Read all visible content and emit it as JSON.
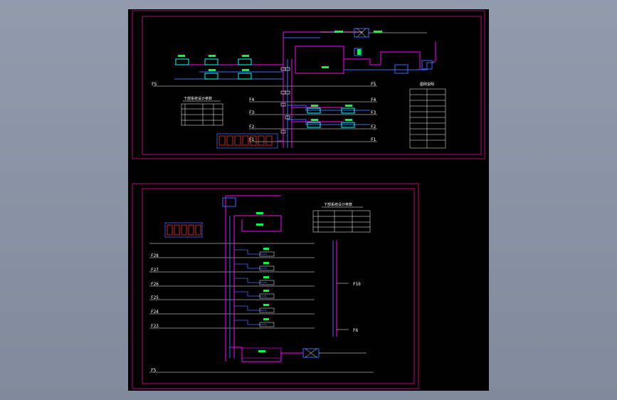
{
  "drawing": {
    "top_floor_labels": [
      "F5",
      "F4",
      "F3",
      "F2",
      "F1"
    ],
    "top_right_floor_labels": [
      "F5",
      "F4",
      "F3",
      "F2",
      "F1"
    ],
    "top_table_title": "下部系统设计参数",
    "top_legend_title": "图例说明",
    "bottom_floor_labels": [
      "F28",
      "F27",
      "F26",
      "F25",
      "F24",
      "F23",
      "F5"
    ],
    "bottom_right_labels": [
      "F16",
      "F6"
    ],
    "bottom_table_title": "下部系统设计参数"
  },
  "colors": {
    "frame": "#c0007a",
    "pipe_magenta": "#ff00ff",
    "pipe_blue": "#3a6bff",
    "symbol_green": "#00ff3c",
    "symbol_cyan": "#00ffff",
    "text_white": "#ffffff",
    "background": "#000000"
  }
}
